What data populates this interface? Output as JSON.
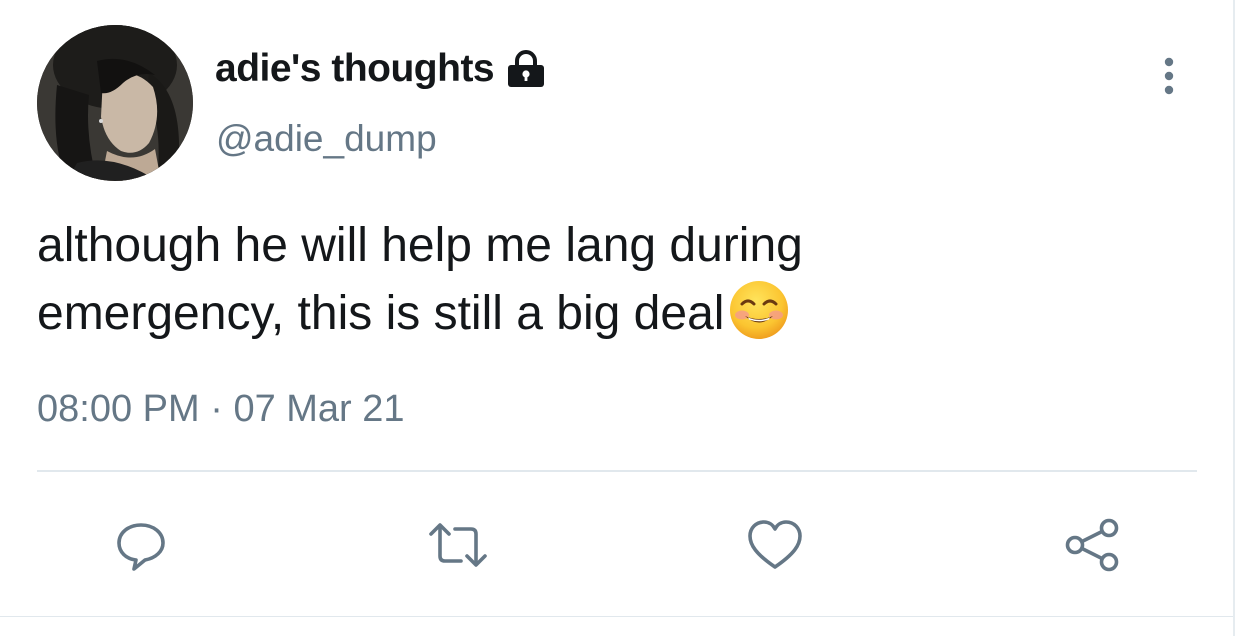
{
  "tweet": {
    "display_name": "adie's thoughts",
    "handle": "@adie_dump",
    "text_line1": "although he will help me lang during",
    "text_line2": "emergency, this is still a big deal",
    "time": "08:00 PM",
    "separator": " · ",
    "date": "07 Mar 21"
  },
  "icons": {
    "lock": "lock-icon",
    "more": "more-vertical-icon",
    "emoji": "smiling-face-with-smiling-eyes-emoji",
    "reply": "reply-icon",
    "retweet": "retweet-icon",
    "like": "heart-icon",
    "share": "share-icon"
  },
  "colors": {
    "text_primary": "#14171a",
    "text_secondary": "#657786",
    "divider": "#e1e8ed"
  }
}
